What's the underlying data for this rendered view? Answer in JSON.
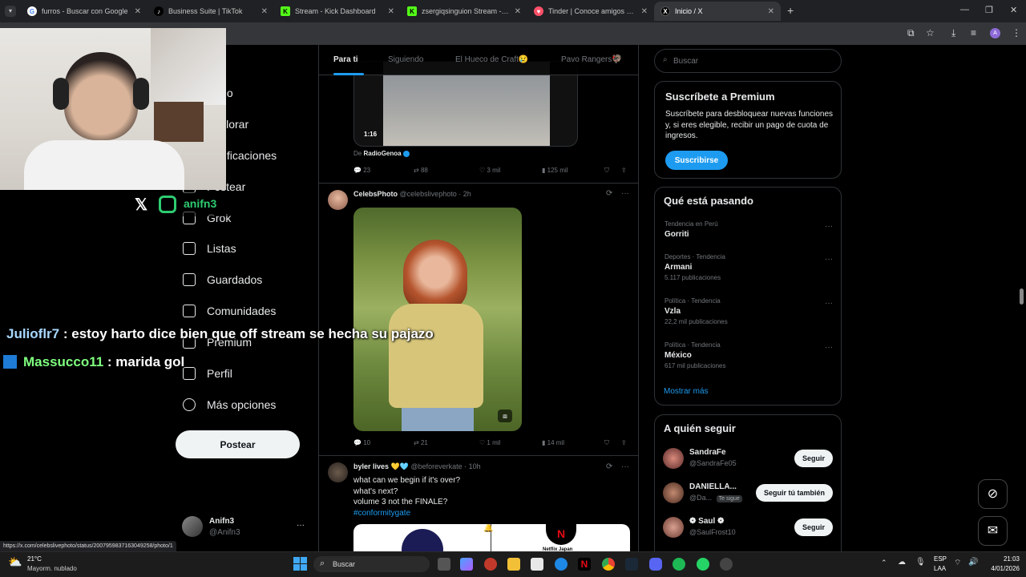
{
  "browser": {
    "tabs": [
      {
        "title": "furros - Buscar con Google",
        "icon": "google-icon",
        "color": "#4285f4"
      },
      {
        "title": "Business Suite | TikTok",
        "icon": "tiktok-icon",
        "color": "#ffffff"
      },
      {
        "title": "Stream - Kick Dashboard",
        "icon": "kick-icon",
        "color": "#53fc18"
      },
      {
        "title": "zsergiqsinguion Stream - Watch",
        "icon": "kick-icon",
        "color": "#53fc18"
      },
      {
        "title": "Tinder | Conoce amigos y gente",
        "icon": "tinder-icon",
        "color": "#fd5068"
      },
      {
        "title": "Inicio / X",
        "icon": "x-icon",
        "color": "#ffffff"
      }
    ],
    "new_tab": "+",
    "status_url": "https://x.com/celebslivephoto/status/2007959837163049258/photo/1"
  },
  "nav": {
    "items": [
      "Inicio",
      "Explorar",
      "Notificaciones",
      "Postear",
      "Grok",
      "Listas",
      "Guardados",
      "Comunidades",
      "Premium",
      "Perfil",
      "Más opciones"
    ],
    "post_button": "Postear",
    "account_name": "Anifn3",
    "account_handle": "@Anifn3",
    "account_more": "···"
  },
  "feed": {
    "tabs": [
      "Para ti",
      "Siguiendo",
      "El Hueco de Craft😢",
      "Pavo Rangers🦃"
    ],
    "post1": {
      "duration": "1:16",
      "from_label": "De",
      "from_name": "RadioGenoa",
      "replies": "23",
      "reposts": "88",
      "likes": "3 mil",
      "views": "125 mil"
    },
    "post2": {
      "name": "CelebsPhoto",
      "handle": "@celebslivephoto",
      "time": "· 2h",
      "replies": "10",
      "reposts": "21",
      "likes": "1 mil",
      "views": "14 mil"
    },
    "post3": {
      "name": "byler lives 💛🩵",
      "handle": "@beforeverkate",
      "time": "· 10h",
      "line1": "what can we begin if it's over?",
      "line2": "what's next?",
      "line3": "volume 3 not the FINALE?",
      "hashtag": "#conformitygate",
      "card_label": "Netflix Japan"
    }
  },
  "right": {
    "search_placeholder": "Buscar",
    "premium": {
      "title": "Suscríbete a Premium",
      "body": "Suscríbete para desbloquear nuevas funciones y, si eres elegible, recibir un pago de cuota de ingresos.",
      "button": "Suscribirse"
    },
    "trending": {
      "title": "Qué está pasando",
      "items": [
        {
          "meta": "Tendencia en Perú",
          "name": "Gorriti",
          "count": ""
        },
        {
          "meta": "Deportes · Tendencia",
          "name": "Armani",
          "count": "5.117 publicaciones"
        },
        {
          "meta": "Política · Tendencia",
          "name": "Vzla",
          "count": "22,2 mil publicaciones"
        },
        {
          "meta": "Política · Tendencia",
          "name": "México",
          "count": "617 mil publicaciones"
        }
      ],
      "more": "Mostrar más"
    },
    "follow": {
      "title": "A quién seguir",
      "items": [
        {
          "name": "SandraFe",
          "handle": "@SandraFe05",
          "button": "Seguir",
          "badge": ""
        },
        {
          "name": "DANIELLA...",
          "handle": "@Da...",
          "button": "Seguir tú también",
          "badge": "Te sigue"
        },
        {
          "name": "❁ Saul ❁",
          "handle": "@SaulFrost10",
          "button": "Seguir",
          "badge": ""
        }
      ]
    }
  },
  "overlay": {
    "social_handle": "anifn3",
    "chat": [
      {
        "user": "Julioflr7",
        "sep": " : ",
        "msg": "estoy harto dice bien que off stream se hecha su pajazo",
        "color": "#a8d8ff"
      },
      {
        "user": "Massucco11",
        "sep": " : ",
        "msg": "marida gol",
        "color": "#7fff7f"
      }
    ]
  },
  "taskbar": {
    "temp": "21°C",
    "weather": "Mayorm. nublado",
    "search": "Buscar",
    "lang1": "ESP",
    "lang2": "LAA",
    "time": "21:03",
    "date": "4/01/2026"
  }
}
